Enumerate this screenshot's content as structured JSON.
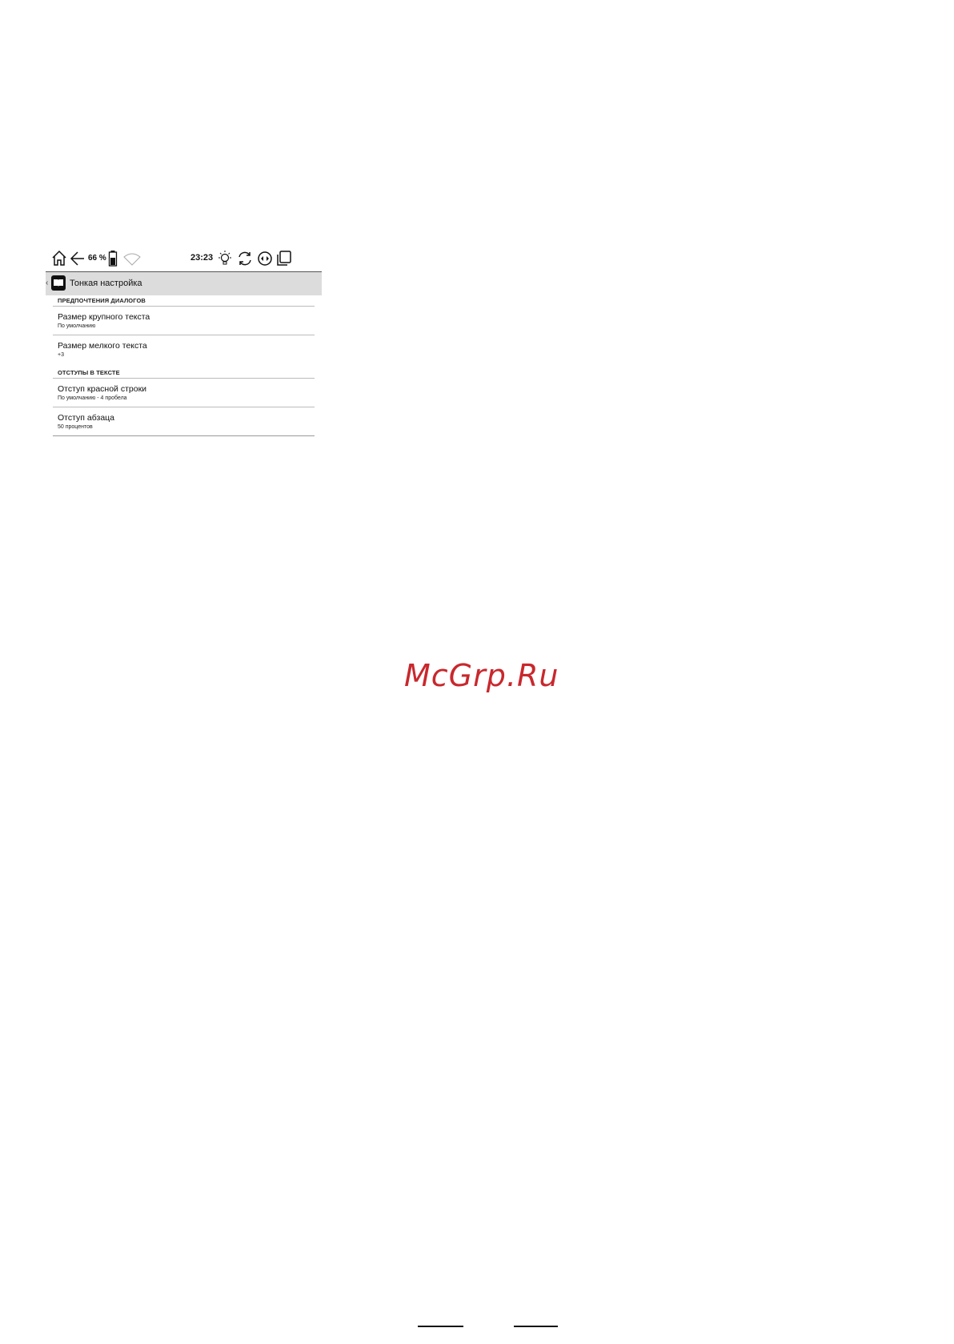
{
  "status_bar": {
    "battery_percent": "66 %",
    "time": "23:23",
    "icons": [
      "home-icon",
      "back-arrow-icon",
      "battery-icon",
      "wifi-icon",
      "light-icon",
      "refresh-icon",
      "page-turn-icon",
      "multitask-icon"
    ]
  },
  "header": {
    "back_glyph": "‹",
    "title": "Тонкая настройка"
  },
  "sections": [
    {
      "title": "ПРЕДПОЧТЕНИЯ ДИАЛОГОВ",
      "items": [
        {
          "title": "Размер крупного текста",
          "subtitle": "По умолчанию"
        },
        {
          "title": "Размер мелкого текста",
          "subtitle": "+3"
        }
      ]
    },
    {
      "title": "ОТСТУПЫ В ТЕКСТЕ",
      "items": [
        {
          "title": "Отступ красной строки",
          "subtitle": "По умолчанию - 4 пробела"
        },
        {
          "title": "Отступ абзаца",
          "subtitle": "50 процентов"
        }
      ]
    }
  ],
  "watermark": "McGrp.Ru",
  "colors": {
    "watermark": "#c8282d",
    "header_bg": "#dcdcdc"
  }
}
